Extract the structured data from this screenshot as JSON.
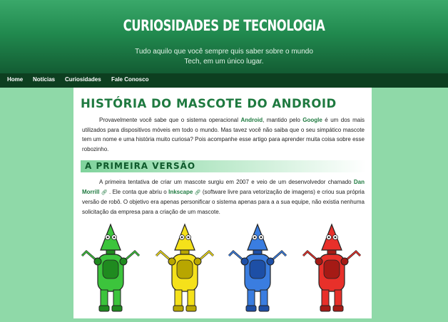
{
  "header": {
    "title": "CURIOSIDADES DE TECNOLOGIA",
    "tagline_line1": "Tudo aquilo que você sempre quis saber sobre o mundo",
    "tagline_line2": "Tech, em um único lugar."
  },
  "nav": {
    "items": [
      {
        "label": "Home"
      },
      {
        "label": "Notícias"
      },
      {
        "label": "Curiosidades"
      },
      {
        "label": "Fale Conosco"
      }
    ]
  },
  "article": {
    "title": "História do Mascote do Android",
    "p1": {
      "t1": "Provavelmente você sabe que o sistema operacional ",
      "android": "Android",
      "t2": ", mantido pelo ",
      "google": "Google",
      "t3": " é um dos mais utilizados para dispositivos móveis em todo o mundo. Mas tavez você não saiba que o seu simpático mascote tem um nome e uma história muito curiosa? Pois acompanhe esse artigo para aprender muita coisa sobre esse robozinho."
    },
    "section1": {
      "title": "A Primeira Versão",
      "p1": {
        "t1": "A primeira tentativa de criar um mascote surgiu em 2007 e veio de um desenvolvedor chamado ",
        "dan": "Dan Morrill",
        "t2": " . Ele conta que abriu o ",
        "inkscape": "Inkscape",
        "t3": " (software livre para vetorização de imagens) e criou sua própria versão de robô. O objetivo era apenas personificar o sistema apenas para a a sua equipe, não existia nenhuma solicitação da empresa para a criação de um mascote."
      }
    }
  },
  "colors": {
    "page_bg": "#8fd9a8",
    "header_top": "#3aa86a",
    "header_bottom": "#135c33",
    "nav_bg": "#0d3f20",
    "accent": "#1f7a40"
  },
  "icons": {
    "external_link": "external-link-icon"
  },
  "robots": [
    {
      "name": "green-robot",
      "color": "#3cc43c",
      "dark": "#1f8a1f"
    },
    {
      "name": "yellow-robot",
      "color": "#f5e11a",
      "dark": "#b8a600"
    },
    {
      "name": "blue-robot",
      "color": "#3a7de0",
      "dark": "#1d4fa6"
    },
    {
      "name": "red-robot",
      "color": "#e8302a",
      "dark": "#a51a15"
    }
  ]
}
